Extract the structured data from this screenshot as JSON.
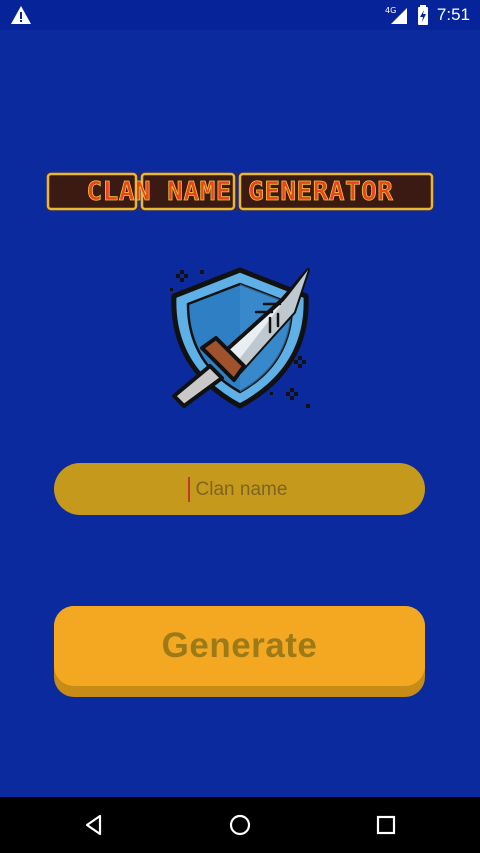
{
  "status_bar": {
    "time": "7:51",
    "network": "4G",
    "icons": [
      "warning-icon",
      "signal-icon",
      "battery-icon"
    ]
  },
  "logo": {
    "text": "CLAN NAME GENERATOR"
  },
  "hero": {
    "icon": "shield-sword-icon"
  },
  "form": {
    "name_value": "",
    "name_placeholder": "Clan name",
    "generate_label": "Generate"
  },
  "nav": {
    "icons": [
      "back-icon",
      "home-icon",
      "recents-icon"
    ]
  },
  "colors": {
    "background": "#0a2a9e",
    "input_fill": "#c59a1c",
    "button_fill": "#f4a822",
    "button_shadow": "#c68c16",
    "button_text": "#9b7a17",
    "logo_text": "#e8441e",
    "logo_outline": "#e8b830"
  }
}
